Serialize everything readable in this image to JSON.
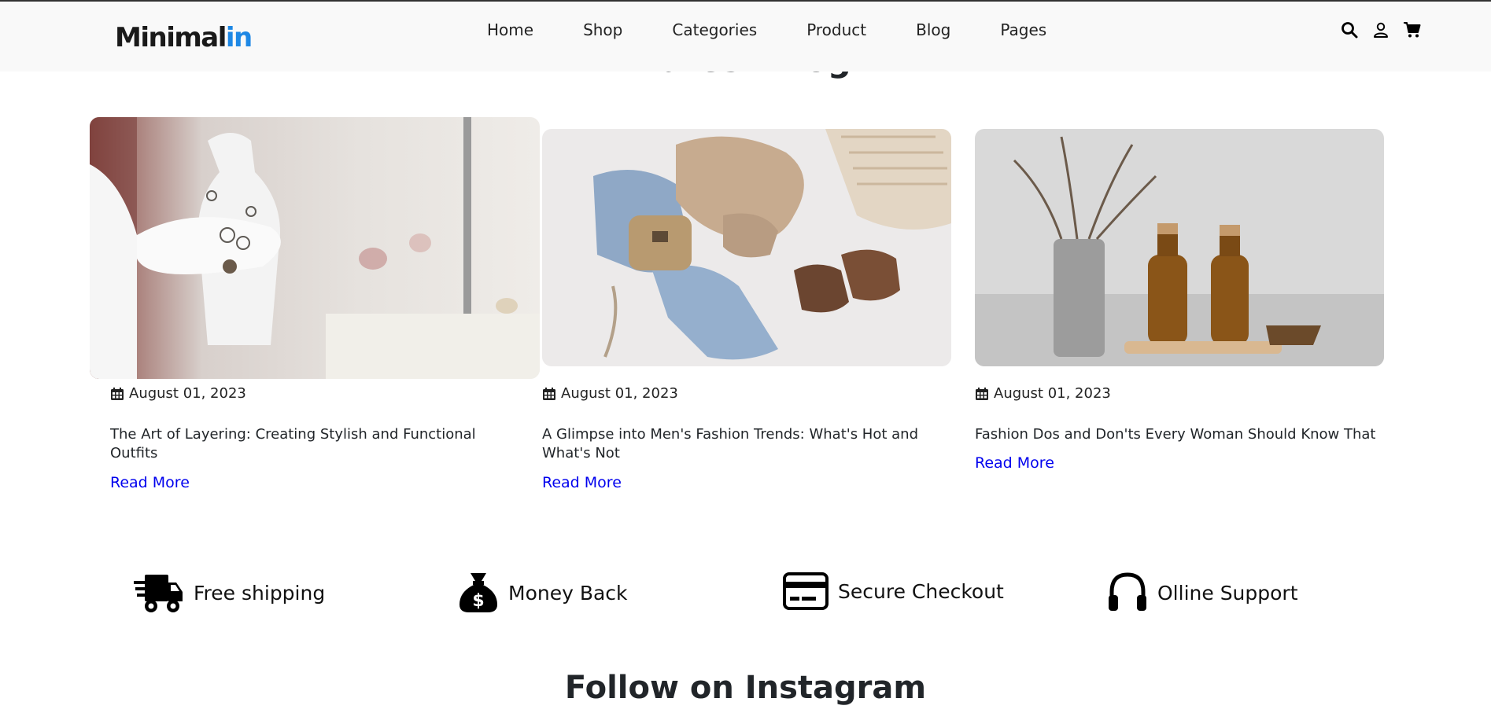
{
  "header": {
    "logo_main": "Minimal",
    "logo_accent": "in",
    "accent_color": "#1e88e5",
    "nav": [
      "Home",
      "Shop",
      "Categories",
      "Product",
      "Blog",
      "Pages"
    ],
    "icons": [
      "search-icon",
      "user-icon",
      "cart-icon"
    ]
  },
  "section": {
    "title": "Latest Blog"
  },
  "blog": {
    "posts": [
      {
        "image": "jewelry-necklace-photo",
        "date": "August 01, 2023",
        "title": "The Art of Layering: Creating Stylish and Functional Outfits",
        "cta": "Read More"
      },
      {
        "image": "clothing-flatlay-photo",
        "date": "August 01, 2023",
        "title": "A Glimpse into Men's Fashion Trends: What's Hot and What's Not",
        "cta": "Read More"
      },
      {
        "image": "bottles-vase-photo",
        "date": "August 01, 2023",
        "title": "Fashion Dos and Don'ts Every Woman Should Know That",
        "cta": "Read More"
      }
    ],
    "link_color": "#0000ee"
  },
  "features": [
    {
      "icon": "truck-icon",
      "label": "Free shipping"
    },
    {
      "icon": "money-bag-icon",
      "label": "Money Back"
    },
    {
      "icon": "credit-card-icon",
      "label": "Secure Checkout"
    },
    {
      "icon": "headphones-icon",
      "label": "Olline Support"
    }
  ],
  "instagram": {
    "title": "Follow on Instagram"
  }
}
